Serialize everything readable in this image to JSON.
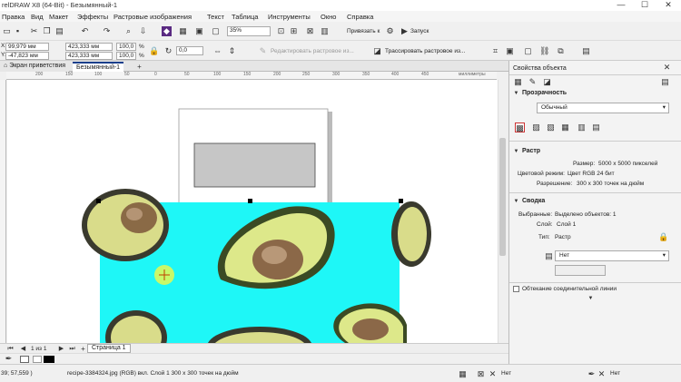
{
  "window": {
    "title": "relDRAW X8 (64-Bit) - Безымянный-1"
  },
  "menu": [
    "Правка",
    "Вид",
    "Макет",
    "Эффекты",
    "Растровые изображения",
    "Текст",
    "Таблица",
    "Инструменты",
    "Окно",
    "Справка"
  ],
  "toolbar": {
    "zoom": "35%",
    "snap_label": "Привязать к",
    "launch_label": "Запуск",
    "x_value": "99,979 мм",
    "y_value": "-47,823 мм",
    "width_value": "423,333 мм",
    "height_value": "423,333 мм",
    "scale_w": "100,0",
    "scale_h": "100,0",
    "percent": "%",
    "angle": "0,0",
    "edit_bitmap_label": "Редактировать растровое из...",
    "trace_label": "Трассировать растровое из..."
  },
  "tabs": {
    "welcome": "Экран приветствия",
    "doc": "Безымянный-1"
  },
  "ruler": {
    "unit": "миллиметры",
    "ticks": [
      "200",
      "150",
      "100",
      "50",
      "0",
      "50",
      "100",
      "150",
      "200",
      "250",
      "300",
      "350",
      "400",
      "450"
    ]
  },
  "pages": {
    "nav": "1 из 1",
    "page_tab": "Страница 1"
  },
  "panel": {
    "title": "Свойства объекта",
    "transparency": {
      "header": "Прозрачность",
      "mode": "Обычный"
    },
    "raster": {
      "header": "Растр",
      "size_label": "Размер:",
      "size_value": "5000 x 5000 пикселей",
      "color_label": "Цветовой режим:",
      "color_value": "Цвет RGB 24 бит",
      "res_label": "Разрешение:",
      "res_value": "300 x 300 точек на дюйм"
    },
    "summary": {
      "header": "Сводка",
      "selected_label": "Выбранные:",
      "selected_value": "Выделено объектов: 1",
      "layer_label": "Слой:",
      "layer_value": "Слой 1",
      "type_label": "Тип:",
      "type_value": "Растр",
      "wrap_value": "Нет"
    },
    "connector_wrap": "Обтекание соединительной линии"
  },
  "status": {
    "coords": "39; 57,559 )",
    "info": "recipe-3384324.jpg (RGB) вкл. Слой 1 300 x 300 точек на дюйм",
    "fill": "Нет",
    "outline": "Нет"
  },
  "colors": {
    "accent": "#1a3f8c",
    "canvas_bg": "#1ef7f7"
  }
}
